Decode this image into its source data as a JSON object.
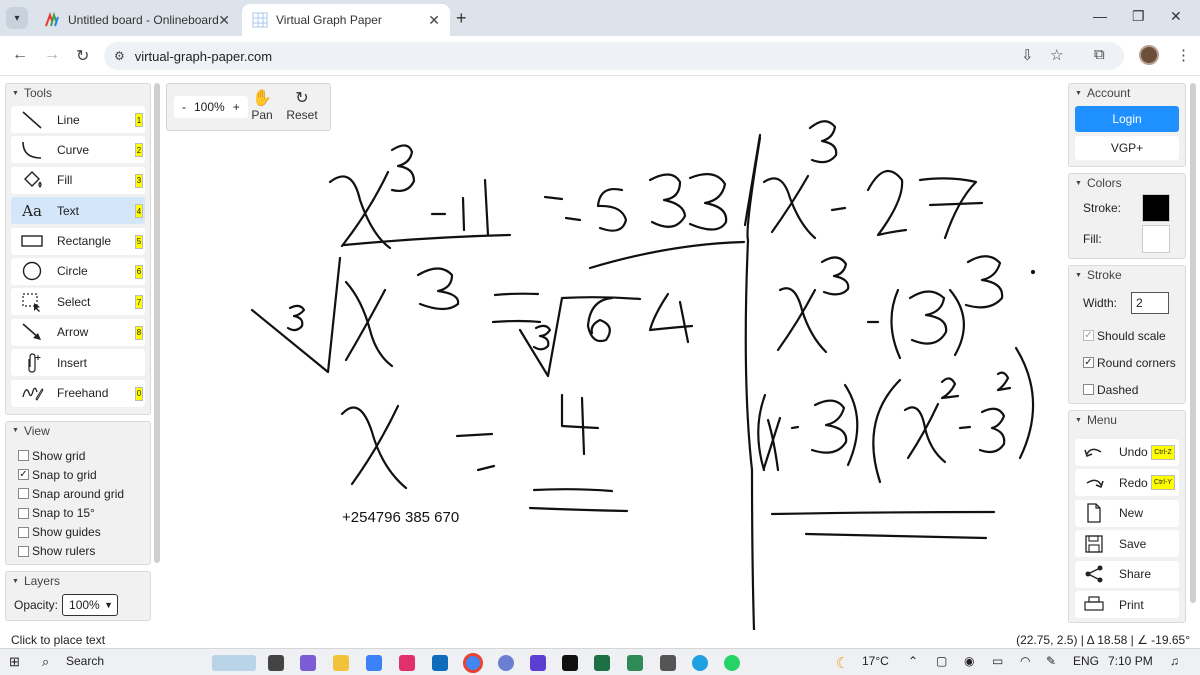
{
  "browser": {
    "tabs": [
      {
        "title": "Untitled board - Onlineboard",
        "active": false
      },
      {
        "title": "Virtual Graph Paper",
        "active": true
      }
    ],
    "url": "virtual-graph-paper.com"
  },
  "tools_panel": {
    "title": "Tools",
    "items": [
      {
        "label": "Line",
        "key": "1",
        "icon": "line-icon"
      },
      {
        "label": "Curve",
        "key": "2",
        "icon": "curve-icon"
      },
      {
        "label": "Fill",
        "key": "3",
        "icon": "fill-bucket-icon"
      },
      {
        "label": "Text",
        "key": "4",
        "icon": "text-icon",
        "active": true
      },
      {
        "label": "Rectangle",
        "key": "5",
        "icon": "rectangle-icon"
      },
      {
        "label": "Circle",
        "key": "6",
        "icon": "circle-icon"
      },
      {
        "label": "Select",
        "key": "7",
        "icon": "select-icon"
      },
      {
        "label": "Arrow",
        "key": "8",
        "icon": "arrow-icon"
      },
      {
        "label": "Insert",
        "key": "",
        "icon": "paperclip-icon"
      },
      {
        "label": "Freehand",
        "key": "0",
        "icon": "freehand-icon"
      }
    ]
  },
  "view_panel": {
    "title": "View",
    "options": [
      {
        "label": "Show grid",
        "checked": false
      },
      {
        "label": "Snap to grid",
        "checked": true
      },
      {
        "label": "Snap around grid",
        "checked": false
      },
      {
        "label": "Snap to 15°",
        "checked": false
      },
      {
        "label": "Show guides",
        "checked": false
      },
      {
        "label": "Show rulers",
        "checked": false
      }
    ]
  },
  "layers_panel": {
    "title": "Layers",
    "opacity_label": "Opacity:",
    "opacity_value": "100%"
  },
  "zoom": {
    "minus": "-",
    "level": "100%",
    "plus": "+",
    "pan_label": "Pan",
    "reset_label": "Reset"
  },
  "canvas": {
    "phone_text": "+254796 385 670"
  },
  "account_panel": {
    "title": "Account",
    "login_label": "Login",
    "vgp_label": "VGP+"
  },
  "colors_panel": {
    "title": "Colors",
    "stroke_label": "Stroke:",
    "fill_label": "Fill:",
    "stroke_color": "#000000",
    "fill_color": "#ffffff"
  },
  "stroke_panel": {
    "title": "Stroke",
    "width_label": "Width:",
    "width_value": "2",
    "options": [
      {
        "label": "Should scale",
        "checked": true,
        "disabled": true
      },
      {
        "label": "Round corners",
        "checked": true
      },
      {
        "label": "Dashed",
        "checked": false
      }
    ]
  },
  "menu_panel": {
    "title": "Menu",
    "items": [
      {
        "label": "Undo",
        "key": "Ctrl-Z",
        "icon": "undo-icon"
      },
      {
        "label": "Redo",
        "key": "Ctrl-Y",
        "icon": "redo-icon"
      },
      {
        "label": "New",
        "key": "",
        "icon": "new-file-icon"
      },
      {
        "label": "Save",
        "key": "",
        "icon": "save-icon"
      },
      {
        "label": "Share",
        "key": "",
        "icon": "share-icon"
      },
      {
        "label": "Print",
        "key": "",
        "icon": "print-icon"
      }
    ]
  },
  "status": {
    "left": "Click to place text",
    "right": "(22.75, 2.5) | Δ 18.58 | ∠ -19.65°"
  },
  "taskbar": {
    "search_label": "Search",
    "weather": "17°C",
    "language": "ENG",
    "time": "7:10 PM"
  }
}
